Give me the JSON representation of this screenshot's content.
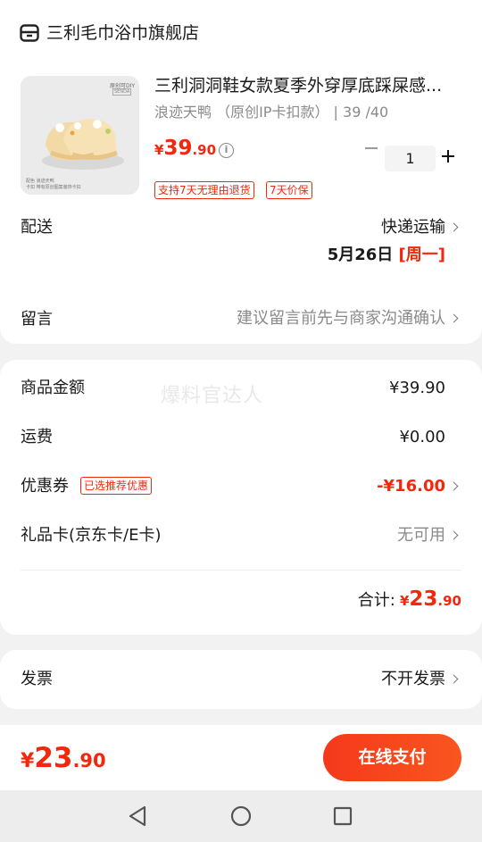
{
  "shop": {
    "name": "三利毛巾浴巾旗舰店",
    "icon": "store-icon"
  },
  "product": {
    "title": "三利洞洞鞋女款夏季外穿厚底踩屎感...",
    "spec": "浪迹天鸭 （原创IP卡扣款） | 39 /40",
    "price": {
      "currency": "¥",
      "int": "39",
      "dec": ".90"
    },
    "quantity": "1",
    "tags": [
      "支持7天无理由退货",
      "7天价保"
    ],
    "thumb_label_top": "原创可DIY",
    "thumb_label_sub": "SENDA",
    "thumb_caption_1": "配色  浪迹天鸭",
    "thumb_caption_2": "卡扣  带有原创图案装饰卡扣"
  },
  "delivery": {
    "label": "配送",
    "method": "快递运输",
    "date": "5月26日",
    "weekday": "[周一]"
  },
  "message": {
    "label": "留言",
    "placeholder": "建议留言前先与商家沟通确认"
  },
  "summary": {
    "goods_label": "商品金额",
    "goods_value": "¥39.90",
    "shipping_label": "运费",
    "shipping_value": "¥0.00",
    "coupon_label": "优惠券",
    "coupon_badge": "已选推荐优惠",
    "coupon_value": "-¥16.00",
    "giftcard_label": "礼品卡(京东卡/E卡)",
    "giftcard_value": "无可用",
    "total_label": "合计:",
    "total": {
      "currency": "¥",
      "int": "23",
      "dec": ".90"
    }
  },
  "watermark": "爆料官达人",
  "invoice": {
    "label": "发票",
    "value": "不开发票"
  },
  "footer": {
    "total": {
      "currency": "¥",
      "int": "23",
      "dec": ".90"
    },
    "pay_label": "在线支付"
  },
  "colors": {
    "accent": "#f2270c",
    "background": "#f2f2f2"
  }
}
